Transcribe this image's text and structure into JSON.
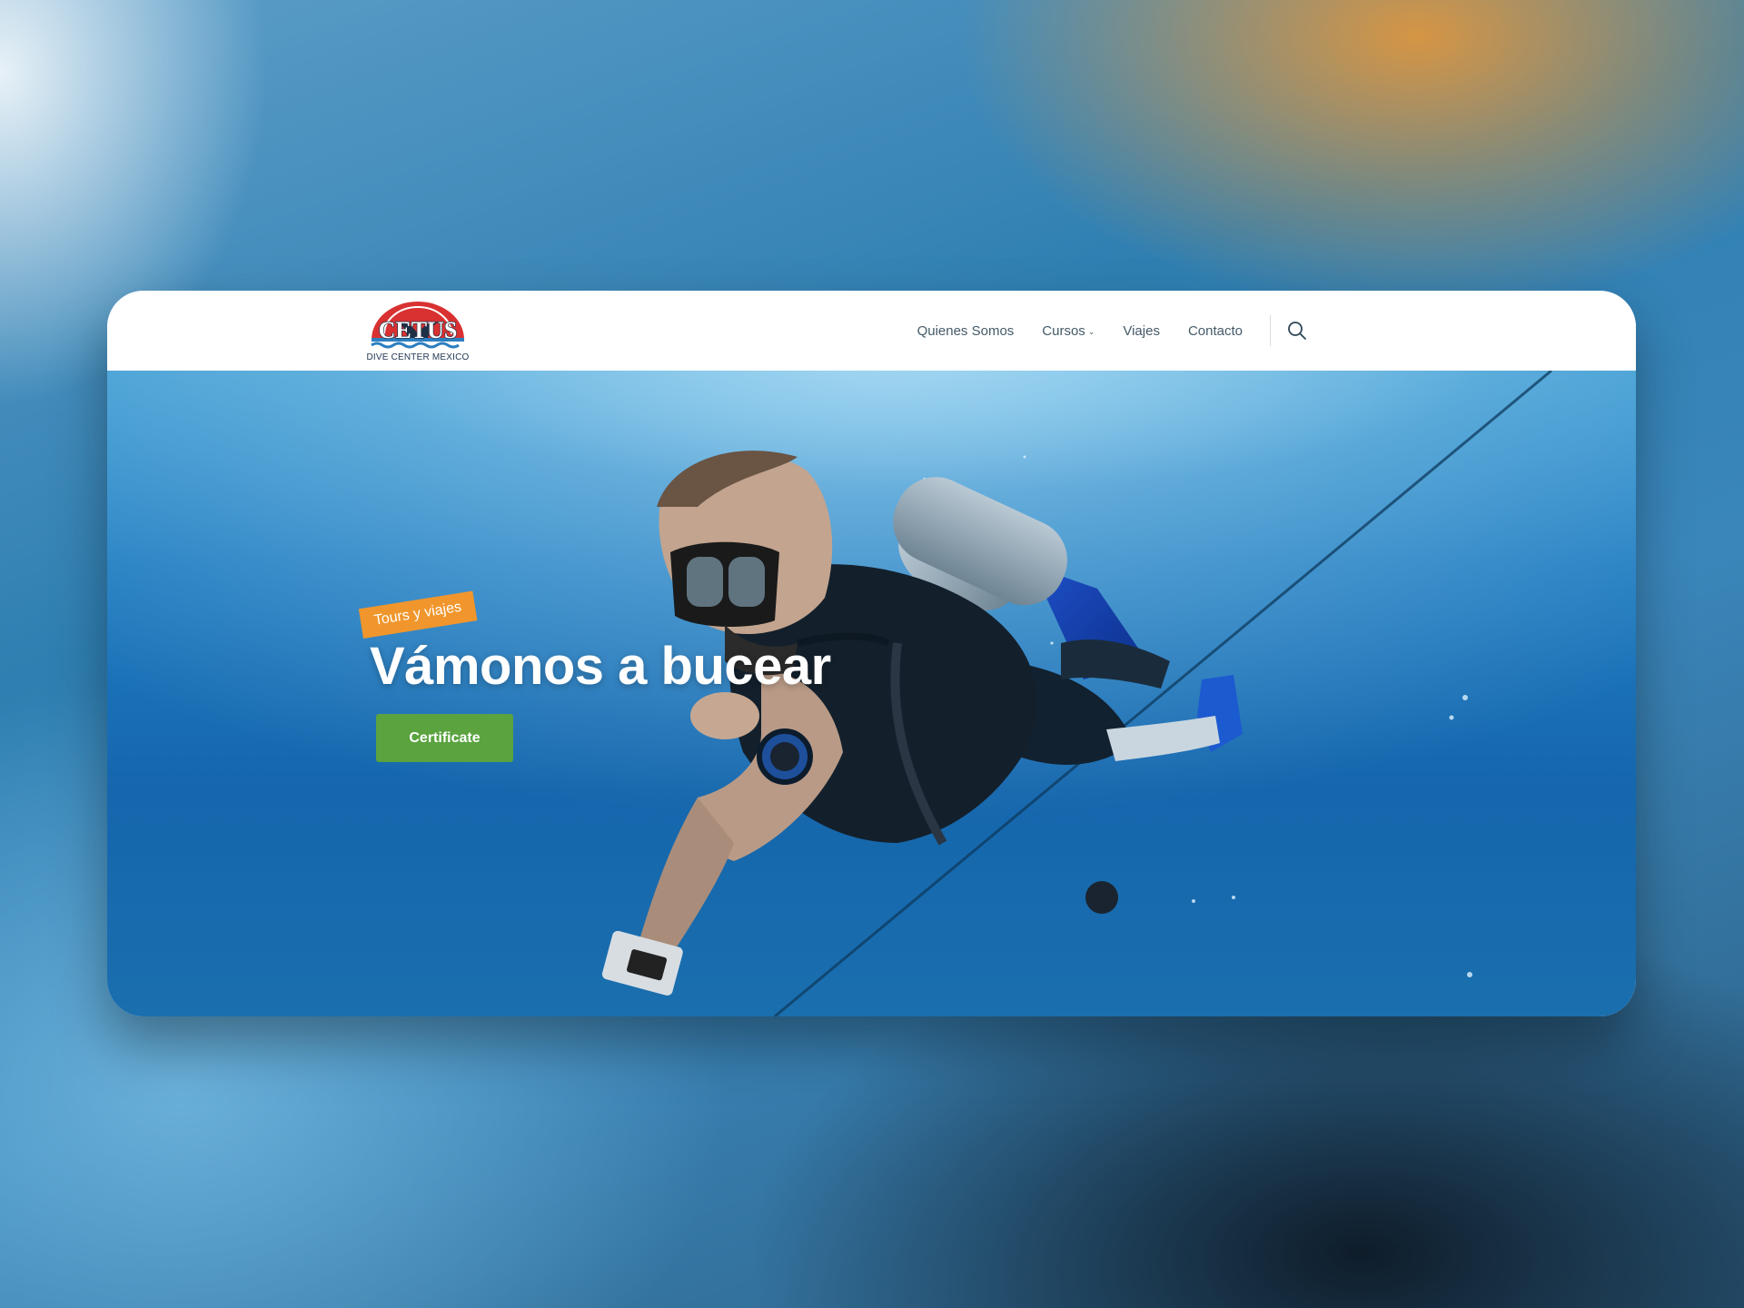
{
  "site": {
    "logo_text": "CETUS",
    "logo_subtitle": "DIVE CENTER MEXICO"
  },
  "nav": {
    "items": [
      {
        "label": "Quienes Somos",
        "has_dropdown": false
      },
      {
        "label": "Cursos",
        "has_dropdown": true
      },
      {
        "label": "Viajes",
        "has_dropdown": false
      },
      {
        "label": "Contacto",
        "has_dropdown": false
      }
    ],
    "dropdown_icon": "chevron-down-icon",
    "search_icon": "search-icon"
  },
  "hero": {
    "tag": "Tours y viajes",
    "headline": "Vámonos a bucear",
    "cta_label": "Certificate",
    "image": "scuba-diver-underwater"
  },
  "colors": {
    "tag_background": "#f0962c",
    "cta_background": "#5aa33f",
    "nav_text": "#445a68",
    "logo_red": "#d93131"
  }
}
